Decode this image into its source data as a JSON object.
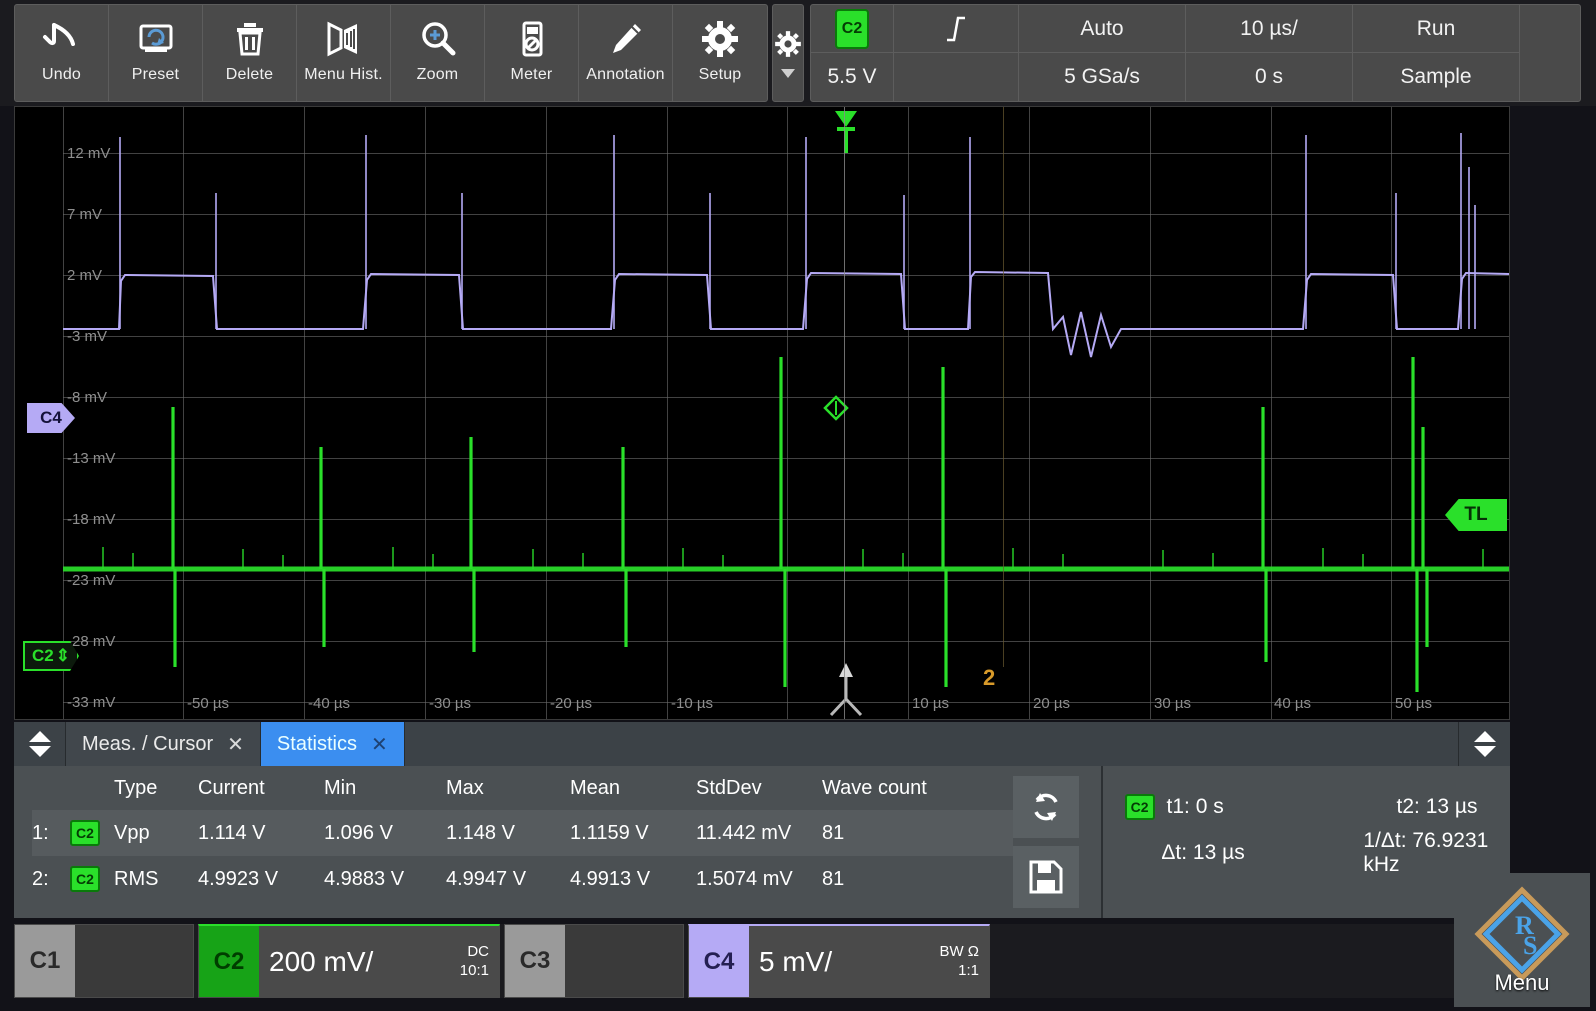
{
  "toolbar": {
    "buttons": [
      {
        "label": "Undo",
        "icon": "undo-icon"
      },
      {
        "label": "Preset",
        "icon": "preset-icon"
      },
      {
        "label": "Delete",
        "icon": "trash-icon"
      },
      {
        "label": "Menu Hist.",
        "icon": "menu-history-icon"
      },
      {
        "label": "Zoom",
        "icon": "zoom-magnifier-icon"
      },
      {
        "label": "Meter",
        "icon": "meter-icon"
      },
      {
        "label": "Annotation",
        "icon": "pencil-icon"
      },
      {
        "label": "Setup",
        "icon": "gear-icon"
      }
    ],
    "settings_icon": "gear-icon",
    "network_icon": "network-icon"
  },
  "status": {
    "trigger_source": "C2",
    "trigger_level": "5.5 V",
    "trigger_slope_icon": "slope-edge-icon",
    "trigger_mode": "Auto",
    "sample_rate": "5 GSa/s",
    "timebase": "10 µs/",
    "time_offset": "0 s",
    "acq_state": "Run",
    "acq_mode": "Sample"
  },
  "waveform": {
    "y_labels": [
      "12 mV",
      "7 mV",
      "2 mV",
      "-3 mV",
      "-8 mV",
      "-13 mV",
      "-18 mV",
      "-23 mV",
      "-28 mV",
      "-33 mV"
    ],
    "x_labels": [
      "-50 µs",
      "-40 µs",
      "-30 µs",
      "-20 µs",
      "-10 µs",
      "10 µs",
      "20 µs",
      "30 µs",
      "40 µs",
      "50 µs"
    ],
    "markers": {
      "c4": "C4",
      "c2": "C2",
      "c2_bottom": "C2",
      "trigger_level_right": "TL",
      "cursor2_label": "2"
    },
    "colors": {
      "c2": "#2ae02a",
      "c4": "#b5aaf5",
      "grid": "#6b6b6b",
      "cursor": "#d89a2a"
    }
  },
  "tabs": [
    {
      "label": "Meas. / Cursor",
      "active": false,
      "close_icon": "close-icon"
    },
    {
      "label": "Statistics",
      "active": true,
      "close_icon": "close-icon"
    }
  ],
  "statistics": {
    "headers": [
      "Type",
      "Current",
      "Min",
      "Max",
      "Mean",
      "StdDev",
      "Wave count"
    ],
    "rows": [
      {
        "index": "1:",
        "source": "C2",
        "type": "Vpp",
        "current": "1.114 V",
        "min": "1.096 V",
        "max": "1.148 V",
        "mean": "1.1159 V",
        "stddev": "11.442 mV",
        "wave_count": "81"
      },
      {
        "index": "2:",
        "source": "C2",
        "type": "RMS",
        "current": "4.9923 V",
        "min": "4.9883 V",
        "max": "4.9947 V",
        "mean": "4.9913 V",
        "stddev": "1.5074 mV",
        "wave_count": "81"
      }
    ],
    "buttons": [
      {
        "name": "reset-statistics",
        "icon": "refresh-icon"
      },
      {
        "name": "save-statistics",
        "icon": "save-floppy-icon"
      }
    ]
  },
  "cursor": {
    "source": "C2",
    "t1": "t1: 0 s",
    "t2": "t2: 13 µs",
    "dt": "Δt: 13 µs",
    "inv_dt": "1/Δt: 76.9231 kHz"
  },
  "channels": [
    {
      "name": "C1",
      "label": "C1",
      "scale": "",
      "coupling": "",
      "probe": "",
      "active": false
    },
    {
      "name": "C2",
      "label": "C2",
      "scale": "200 mV/",
      "coupling": "DC",
      "probe": "10:1",
      "active": true
    },
    {
      "name": "C3",
      "label": "C3",
      "scale": "",
      "coupling": "",
      "probe": "",
      "active": false
    },
    {
      "name": "C4",
      "label": "C4",
      "scale": "5 mV/",
      "coupling": "BW Ω",
      "probe": "1:1",
      "active": true
    }
  ],
  "menu": {
    "label": "Menu",
    "logo": "rohde-schwarz-logo"
  }
}
